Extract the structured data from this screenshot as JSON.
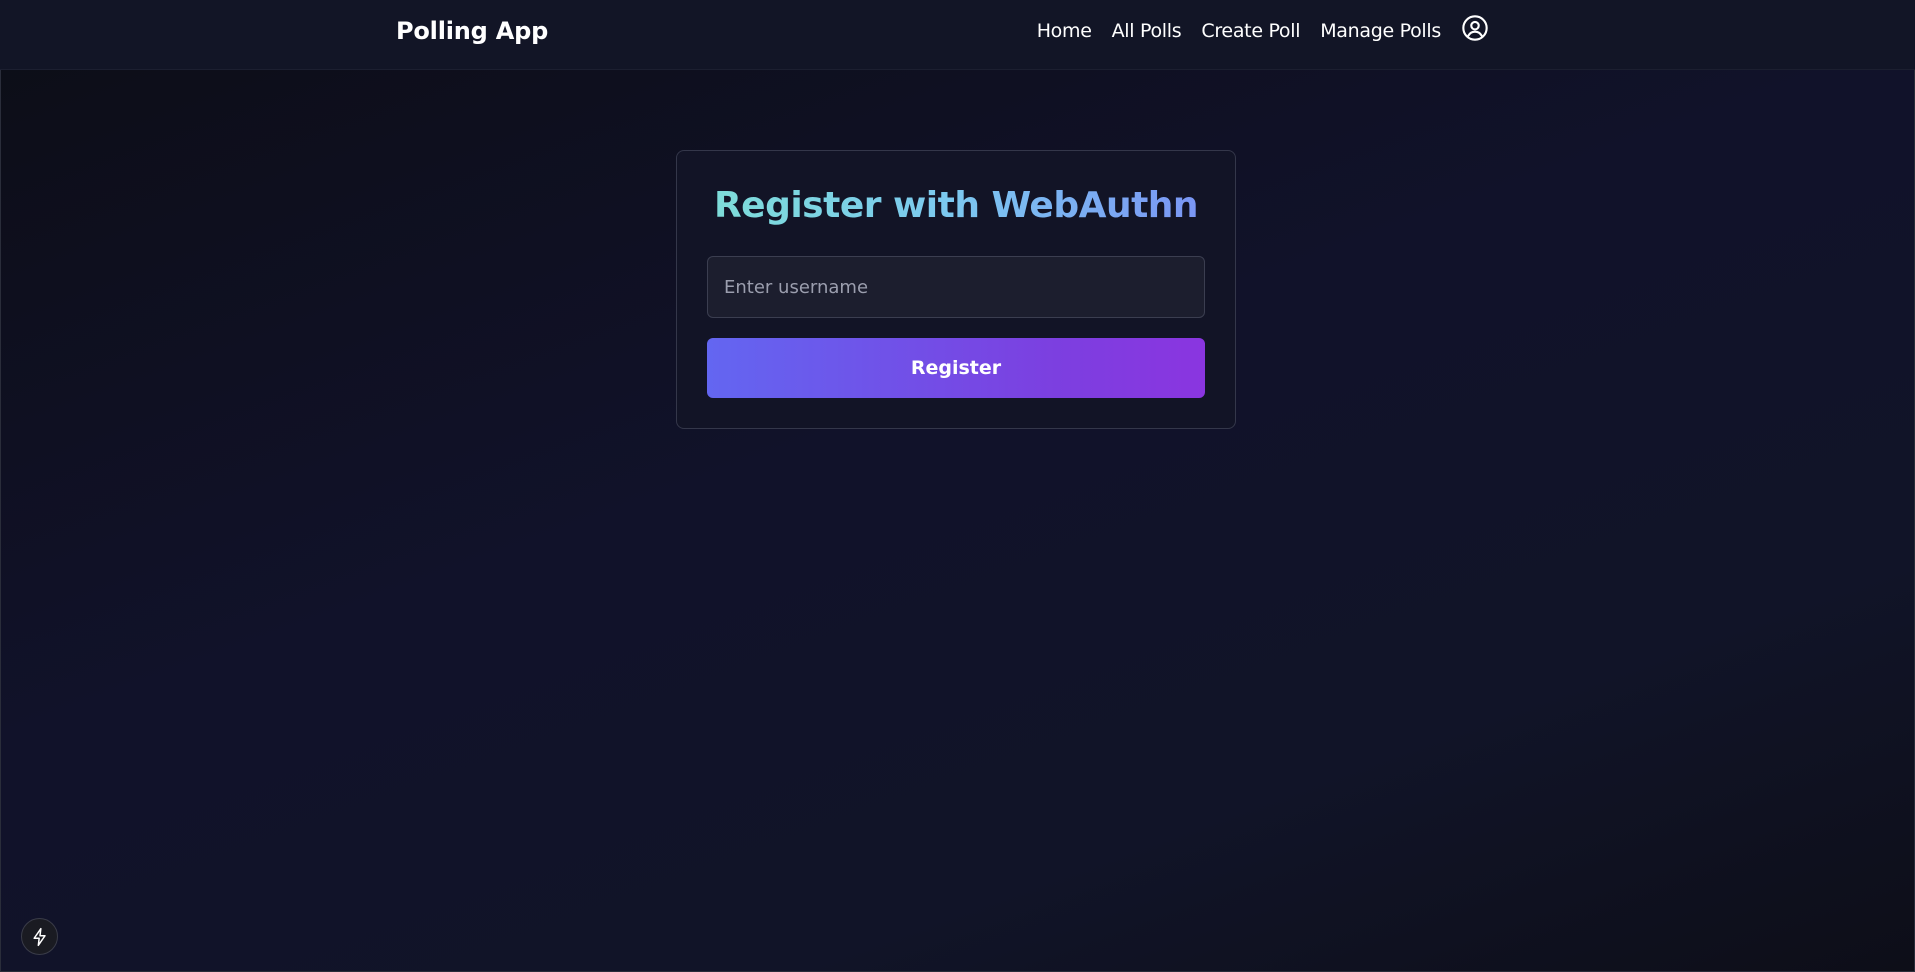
{
  "navbar": {
    "brand": "Polling App",
    "links": [
      {
        "label": "Home"
      },
      {
        "label": "All Polls"
      },
      {
        "label": "Create Poll"
      },
      {
        "label": "Manage Polls"
      }
    ],
    "user_icon": "user-circle-icon"
  },
  "register_card": {
    "title": "Register with WebAuthn",
    "username_placeholder": "Enter username",
    "username_value": "",
    "button_label": "Register"
  },
  "dev_badge": {
    "icon": "lightning-bolt-icon"
  },
  "colors": {
    "background": "#0f1020",
    "navbar": "#121526",
    "card": "#121426",
    "title_gradient_start": "#7ee0d6",
    "title_gradient_end": "#7a8ef5",
    "button_gradient_start": "#6366f1",
    "button_gradient_end": "#8a35e0"
  }
}
